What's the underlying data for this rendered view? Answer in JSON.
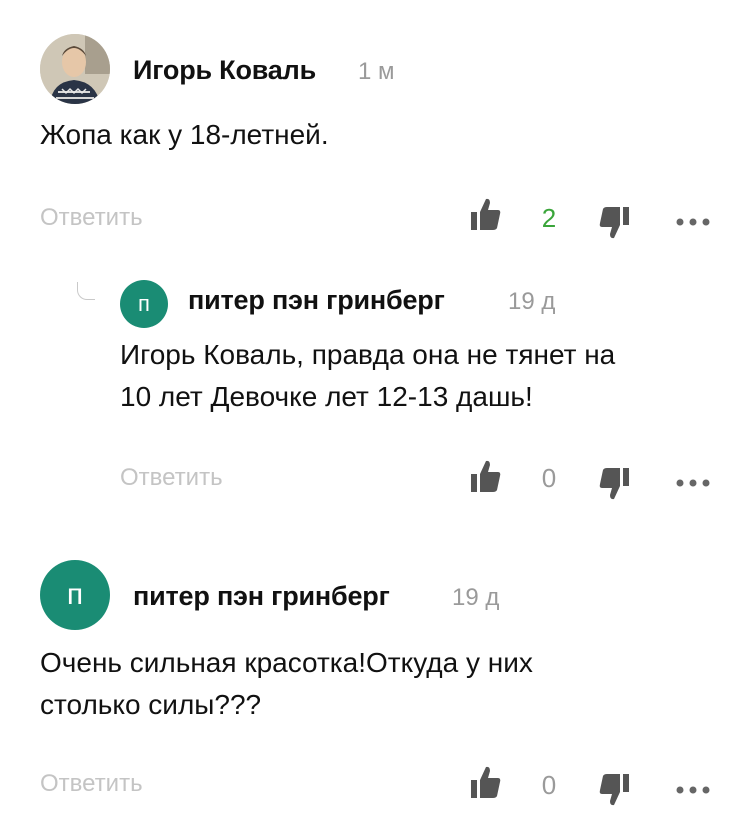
{
  "colors": {
    "accent_green": "#1a8c74",
    "like_count_positive": "#3aa53a",
    "muted_text": "#9a9a9a",
    "icon_gray": "#555555"
  },
  "comments": [
    {
      "author": "Игорь Коваль",
      "time": "1 м",
      "text": "Жопа как у 18-летней.",
      "reply_label": "Ответить",
      "likes": "2",
      "avatar_type": "photo"
    },
    {
      "author": "питер пэн гринберг",
      "time": "19 д",
      "avatar_letter": "п",
      "text_line1": "Игорь Коваль, правда она не тянет на",
      "text_line2": "10 лет Девочке лет 12-13 дашь!",
      "reply_label": "Ответить",
      "likes": "0"
    },
    {
      "author": "питер пэн гринберг",
      "time": "19 д",
      "avatar_letter": "п",
      "text_line1": "Очень сильная красотка!Откуда у них",
      "text_line2": "столько силы???",
      "reply_label": "Ответить",
      "likes": "0"
    }
  ],
  "icons": {
    "like": "thumbs-up-icon",
    "dislike": "thumbs-down-icon",
    "more": "more-dots-icon"
  }
}
